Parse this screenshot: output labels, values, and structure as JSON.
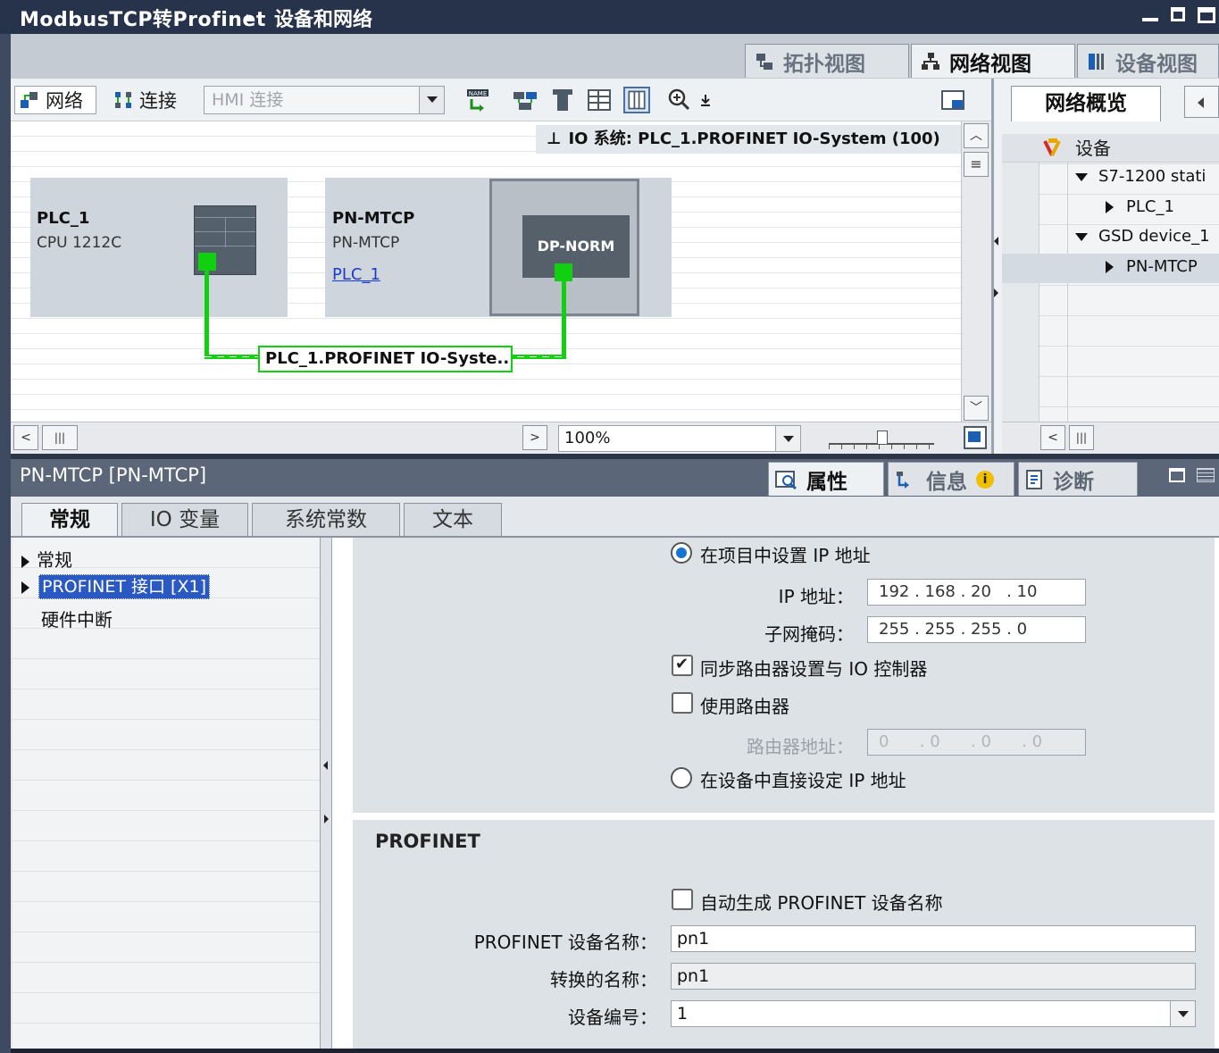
{
  "window": {
    "app": "ModbusTCP转Profinet",
    "sep": "▸",
    "page": "设备和网络"
  },
  "view_tabs": [
    {
      "label": "拓扑视图",
      "icon": "topology-icon",
      "active": false
    },
    {
      "label": "网络视图",
      "icon": "network-icon",
      "active": true
    },
    {
      "label": "设备视图",
      "icon": "device-icon",
      "active": false
    }
  ],
  "toolbar": {
    "network_label": "网络",
    "connect_label": "连接",
    "hmi_placeholder": "HMI 连接"
  },
  "io_banner": "IO 系统: PLC_1.PROFINET IO-System (100)",
  "devices": {
    "plc": {
      "name": "PLC_1",
      "type": "CPU 1212C"
    },
    "pn": {
      "name": "PN-MTCP",
      "type": "PN-MTCP",
      "link": "PLC_1",
      "module": "DP-NORM"
    }
  },
  "network_label": "PLC_1.PROFINET IO-Syste...",
  "zoom": "100%",
  "overview": {
    "tab": "网络概览",
    "header": "设备",
    "rows": [
      {
        "label": "S7-1200 stati",
        "expanded": true,
        "indent": 0
      },
      {
        "label": "PLC_1",
        "expanded": false,
        "indent": 1
      },
      {
        "label": "GSD device_1",
        "expanded": true,
        "indent": 0
      },
      {
        "label": "PN-MTCP",
        "expanded": false,
        "indent": 1
      }
    ]
  },
  "properties": {
    "title": "PN-MTCP [PN-MTCP]",
    "tabs": [
      {
        "label": "属性",
        "active": true
      },
      {
        "label": "信息",
        "active": false
      },
      {
        "label": "诊断",
        "active": false
      }
    ],
    "subtabs": [
      "常规",
      "IO 变量",
      "系统常数",
      "文本"
    ],
    "nav": {
      "item1": "常规",
      "item2": "PROFINET 接口 [X1]",
      "item3": "硬件中断"
    },
    "ip": {
      "opt_project": "在项目中设置 IP 地址",
      "ip_label": "IP 地址：",
      "ip_value": "192 . 168 . 20   . 10",
      "mask_label": "子网掩码：",
      "mask_value": "255 . 255 . 255 . 0",
      "sync_label": "同步路由器设置与 IO 控制器",
      "router_label": "使用路由器",
      "router_addr_label": "路由器地址：",
      "router_addr_value": "0      . 0      . 0      . 0",
      "opt_device": "在设备中直接设定 IP 地址"
    },
    "profinet": {
      "heading": "PROFINET",
      "auto_label": "自动生成 PROFINET 设备名称",
      "name_label": "PROFINET 设备名称：",
      "name_value": "pn1",
      "conv_label": "转换的名称：",
      "conv_value": "pn1",
      "num_label": "设备编号：",
      "num_value": "1"
    }
  }
}
